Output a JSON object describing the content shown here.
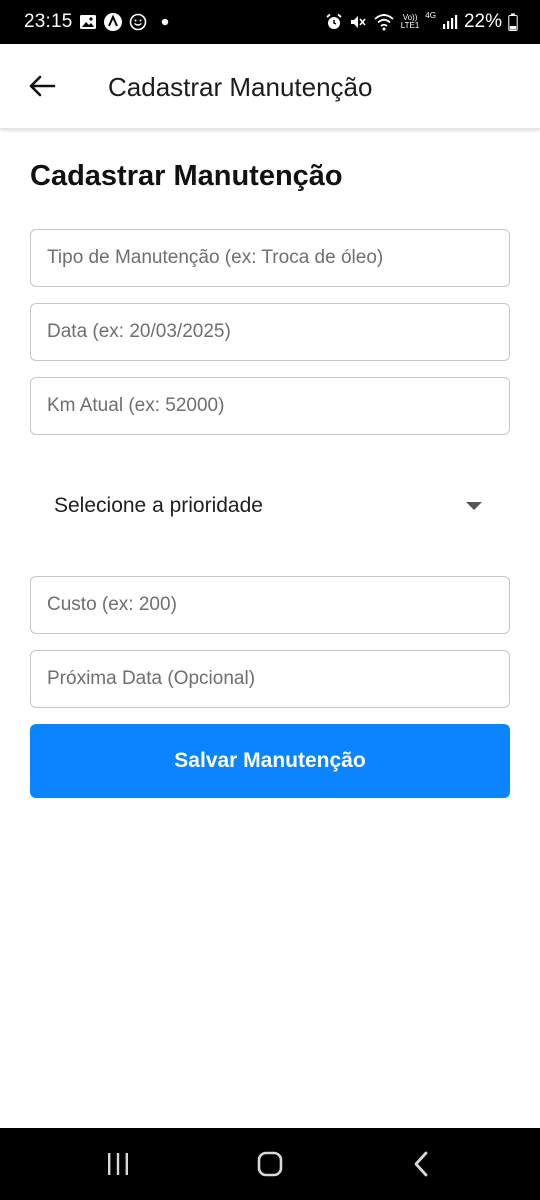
{
  "status_bar": {
    "time": "23:15",
    "network_top": "Vo))",
    "network_bottom": "LTE1",
    "network_gen": "4G",
    "battery_percent": "22%",
    "icons_left": [
      "image-icon",
      "app-a-icon",
      "smiley-icon",
      "dot-icon"
    ],
    "icons_right": [
      "alarm-icon",
      "mute-icon",
      "wifi-icon",
      "signal-icon",
      "battery-icon"
    ]
  },
  "app_bar": {
    "title": "Cadastrar Manutenção",
    "back_icon": "arrow-left-icon"
  },
  "form": {
    "heading": "Cadastrar Manutenção",
    "tipo_placeholder": "Tipo de Manutenção (ex: Troca de óleo)",
    "data_placeholder": "Data (ex: 20/03/2025)",
    "km_placeholder": "Km Atual (ex: 52000)",
    "prioridade_selected": "Selecione a prioridade",
    "custo_placeholder": "Custo (ex: 200)",
    "proxima_data_placeholder": "Próxima Data (Opcional)",
    "save_label": "Salvar Manutenção"
  },
  "nav_bar": {
    "icons": [
      "recent-apps-icon",
      "home-icon",
      "back-icon"
    ]
  },
  "colors": {
    "accent": "#0a84ff",
    "status_bar_bg": "#000000",
    "nav_bar_bg": "#000000",
    "field_border": "#c7c7c7"
  }
}
